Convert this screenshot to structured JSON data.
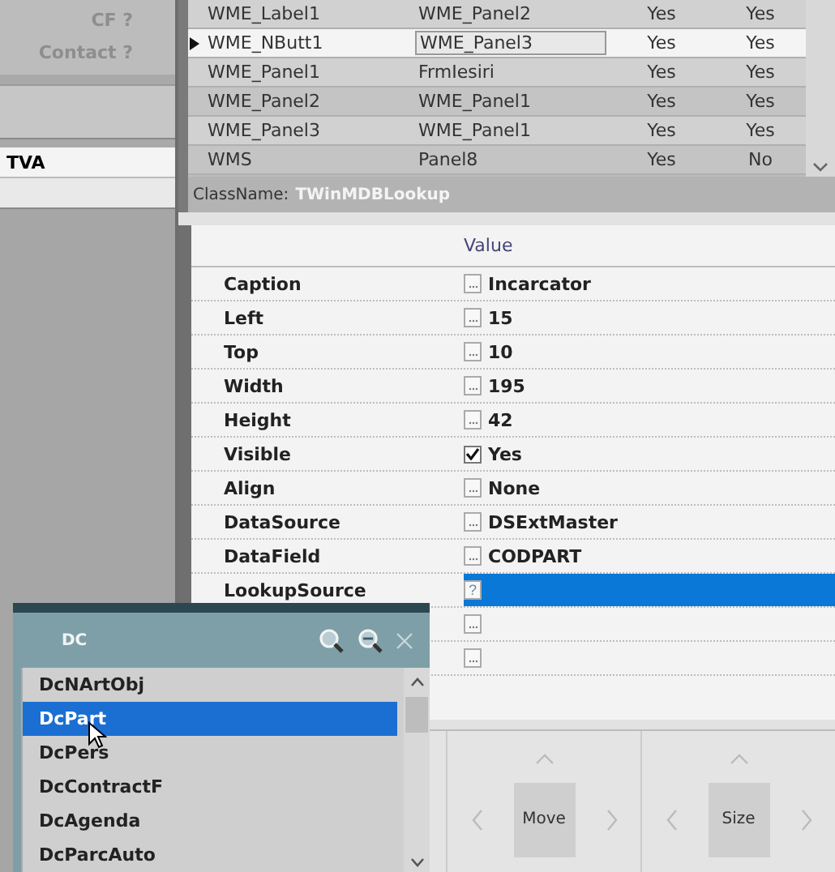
{
  "left_panel": {
    "fields": [
      {
        "label": "CF ?"
      },
      {
        "label": "Contact ?"
      }
    ],
    "section": "TVA"
  },
  "components_grid": {
    "rows": [
      {
        "cells": [
          "WME_Label1",
          "WME_Panel2",
          "Yes",
          "Yes"
        ],
        "selected": false
      },
      {
        "cells": [
          "WME_NButt1",
          "WME_Panel3",
          "Yes",
          "Yes"
        ],
        "selected": true
      },
      {
        "cells": [
          "WME_Panel1",
          "FrmIesiri",
          "Yes",
          "Yes"
        ],
        "selected": false
      },
      {
        "cells": [
          "WME_Panel2",
          "WME_Panel1",
          "Yes",
          "Yes"
        ],
        "selected": false
      },
      {
        "cells": [
          "WME_Panel3",
          "WME_Panel1",
          "Yes",
          "Yes"
        ],
        "selected": false
      },
      {
        "cells": [
          "WMS",
          "Panel8",
          "Yes",
          "No"
        ],
        "selected": false
      }
    ]
  },
  "class_name": {
    "label": "ClassName:",
    "value": "TWinMDBLookup"
  },
  "inspector": {
    "header": "Value",
    "properties": [
      {
        "kind": "text",
        "name": "Caption",
        "value": "Incarcator",
        "selected": false
      },
      {
        "kind": "text",
        "name": "Left",
        "value": "15",
        "selected": false
      },
      {
        "kind": "text",
        "name": "Top",
        "value": "10",
        "selected": false
      },
      {
        "kind": "text",
        "name": "Width",
        "value": "195",
        "selected": false
      },
      {
        "kind": "text",
        "name": "Height",
        "value": "42",
        "selected": false
      },
      {
        "kind": "check",
        "name": "Visible",
        "value": "Yes",
        "checked": true,
        "selected": false
      },
      {
        "kind": "text",
        "name": "Align",
        "value": "None",
        "selected": false
      },
      {
        "kind": "text",
        "name": "DataSource",
        "value": "DSExtMaster",
        "selected": false
      },
      {
        "kind": "text",
        "name": "DataField",
        "value": "CODPART",
        "selected": false
      },
      {
        "kind": "lookup",
        "name": "LookupSource",
        "button": "?",
        "selected": true
      },
      {
        "kind": "text",
        "selected": false
      },
      {
        "kind": "text",
        "selected": false
      }
    ]
  },
  "lookup_popup": {
    "title": "DC",
    "items": [
      {
        "label": "DcNArtObj",
        "selected": false
      },
      {
        "label": "DcPart",
        "selected": true
      },
      {
        "label": "DcPers",
        "selected": false
      },
      {
        "label": "DcContractF",
        "selected": false
      },
      {
        "label": "DcAgenda",
        "selected": false
      },
      {
        "label": "DcParcAuto",
        "selected": false
      }
    ]
  },
  "nav_controls": [
    {
      "label": "Move"
    },
    {
      "label": "Size"
    }
  ]
}
